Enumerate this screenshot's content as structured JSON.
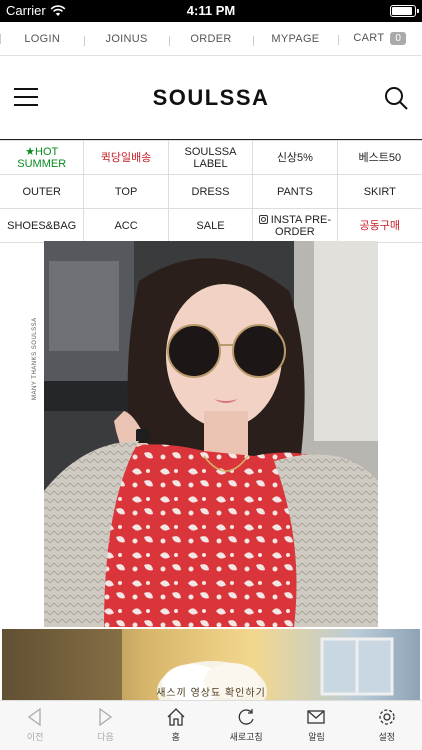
{
  "status": {
    "carrier": "Carrier",
    "time": "4:11 PM"
  },
  "top_nav": {
    "login": "LOGIN",
    "joinus": "JOINUS",
    "order": "ORDER",
    "mypage": "MYPAGE",
    "cart": "CART",
    "cart_count": "0"
  },
  "header": {
    "logo": "SOULSSA"
  },
  "categories": {
    "hot": "★HOT SUMMER",
    "same_day": "퀵당일배송",
    "label": "SOULSSA LABEL",
    "new5": "신상5%",
    "best50": "베스트50",
    "outer": "OUTER",
    "top": "TOP",
    "dress": "DRESS",
    "pants": "PANTS",
    "skirt": "SKIRT",
    "shoes_bag": "SHOES&BAG",
    "acc": "ACC",
    "sale": "SALE",
    "insta": "INSTA PRE-ORDER",
    "group_buy": "공동구매"
  },
  "photo": {
    "watermark": "MANY THANKS SOULSSA"
  },
  "banner": {
    "text": "새스끼 영상됴 확인하기"
  },
  "tabs": {
    "back": "이전",
    "forward": "다음",
    "home": "홈",
    "refresh": "새로고침",
    "notice": "알림",
    "settings": "설정"
  },
  "colors": {
    "hot": "#0a8a1e",
    "accent_red": "#c8202a"
  }
}
